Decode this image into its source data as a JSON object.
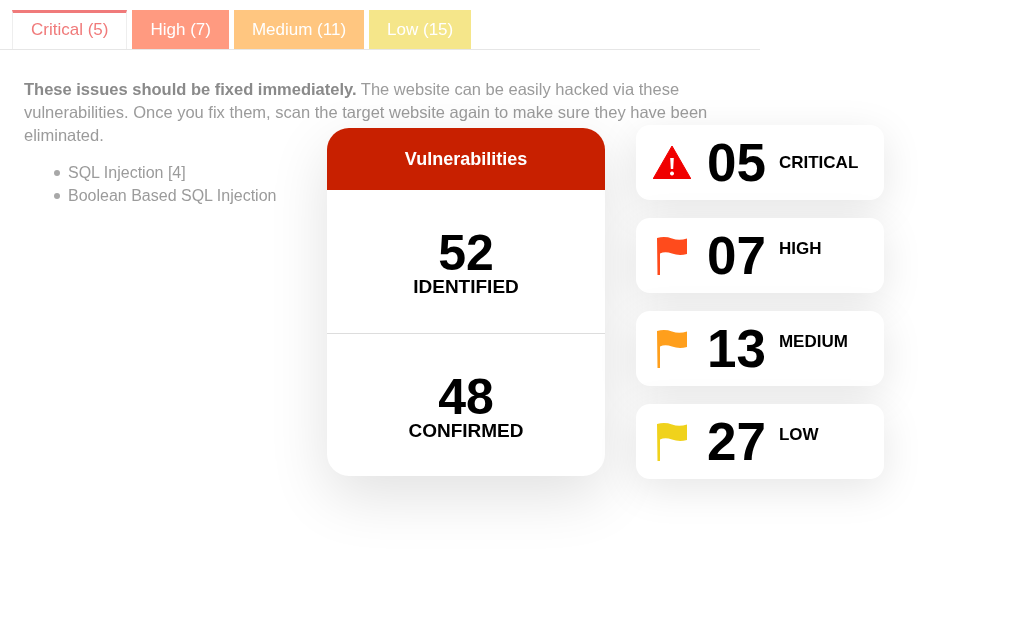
{
  "tabs": [
    {
      "label": "Critical (5)",
      "selected": true,
      "color": "#f07a7a"
    },
    {
      "label": "High (7)",
      "selected": false,
      "color": "#ff9a80"
    },
    {
      "label": "Medium (11)",
      "selected": false,
      "color": "#ffc680"
    },
    {
      "label": "Low (15)",
      "selected": false,
      "color": "#f5e68a"
    }
  ],
  "description": "**These issues should be fixed immediately.** The website can be easily hacked via these vulnerabilities. Once you fix them, scan the target website again to make sure they have been eliminated.",
  "issues": [
    "SQL Injection [4]",
    "Boolean Based SQL Injection"
  ],
  "vulnerabilities": {
    "title": "Vulnerabilities",
    "stats": [
      {
        "value": "52",
        "label": "IDENTIFIED"
      },
      {
        "value": "48",
        "label": "CONFIRMED"
      }
    ]
  },
  "severities": [
    {
      "kind": "warning",
      "value": "05",
      "label": "CRITICAL",
      "color": "#f00000"
    },
    {
      "kind": "flag",
      "value": "07",
      "label": "HIGH",
      "color": "#ff4b1c"
    },
    {
      "kind": "flag",
      "value": "13",
      "label": "MEDIUM",
      "color": "#ff9f1c"
    },
    {
      "kind": "flag",
      "value": "27",
      "label": "LOW",
      "color": "#f0d21c"
    }
  ]
}
